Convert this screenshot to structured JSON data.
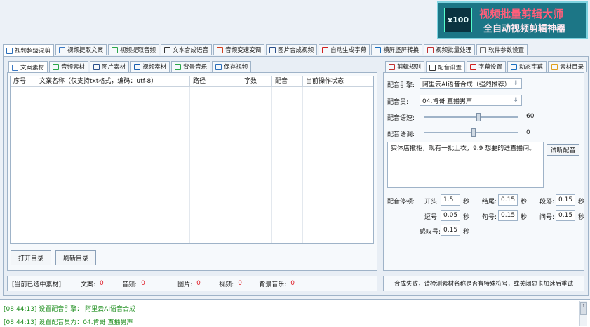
{
  "brand": {
    "badge": "x100",
    "title": "视频批量剪辑大师",
    "subtitle": "全自动视频剪辑神器"
  },
  "main_tabs": [
    {
      "label": "视频超级混剪",
      "icon": "scissors-icon",
      "color": "#2a6db8"
    },
    {
      "label": "视频提取文案",
      "icon": "document-icon",
      "color": "#3a78c2"
    },
    {
      "label": "视频提取音频",
      "icon": "waveform-icon",
      "color": "#2aa64a"
    },
    {
      "label": "文本合成语音",
      "icon": "microphone-icon",
      "color": "#333333"
    },
    {
      "label": "音频变速变调",
      "icon": "gauge-icon",
      "color": "#d04020"
    },
    {
      "label": "图片合成视频",
      "icon": "image-icon",
      "color": "#2a4f8a"
    },
    {
      "label": "自动生成字幕",
      "icon": "font-icon",
      "color": "#d02020"
    },
    {
      "label": "横屏竖屏转换",
      "icon": "rotate-icon",
      "color": "#1a6fbf"
    },
    {
      "label": "视频批量处理",
      "icon": "film-icon",
      "color": "#c03030"
    },
    {
      "label": "软件参数设置",
      "icon": "gear-icon",
      "color": "#666666"
    }
  ],
  "left_tabs": [
    {
      "label": "文案素材",
      "icon": "document-icon",
      "color": "#3a78c2"
    },
    {
      "label": "音频素材",
      "icon": "waveform-icon",
      "color": "#2aa64a"
    },
    {
      "label": "图片素材",
      "icon": "image-icon",
      "color": "#2a4f8a"
    },
    {
      "label": "视频素材",
      "icon": "play-icon",
      "color": "#1a5fb0"
    },
    {
      "label": "背景音乐",
      "icon": "music-icon",
      "color": "#2aa64a"
    },
    {
      "label": "保存视频",
      "icon": "save-icon",
      "color": "#2a6db8"
    }
  ],
  "grid": {
    "columns": [
      "序号",
      "文案名称（仅支持txt格式，编码：utf-8）",
      "路径",
      "字数",
      "配音",
      "当前操作状态"
    ]
  },
  "buttons": {
    "open_dir": "打开目录",
    "refresh_dir": "刷新目录",
    "preview_voice": "试听配音"
  },
  "status": {
    "label": "[当前已选中素材]",
    "items": [
      {
        "label": "文案:",
        "value": "0"
      },
      {
        "label": "音频:",
        "value": "0"
      },
      {
        "label": "图片:",
        "value": "0"
      },
      {
        "label": "视频:",
        "value": "0"
      },
      {
        "label": "背景音乐:",
        "value": "0"
      }
    ]
  },
  "right_tabs": [
    {
      "label": "剪辑规则",
      "icon": "film-icon",
      "color": "#c03030"
    },
    {
      "label": "配音设置",
      "icon": "microphone-icon",
      "color": "#333333"
    },
    {
      "label": "字幕设置",
      "icon": "font-icon",
      "color": "#d02020"
    },
    {
      "label": "动态字幕",
      "icon": "text-box-icon",
      "color": "#1a6fbf"
    },
    {
      "label": "素材目录",
      "icon": "folder-icon",
      "color": "#e0a020"
    }
  ],
  "voice": {
    "engine_label": "配音引擎:",
    "engine_value": "阿里云AI语音合成（强烈推荐）",
    "voice_label": "配音员:",
    "voice_value": "04.肯哥 直播男声",
    "speed_label": "配音语速:",
    "speed_value": "60",
    "speed_fraction": 0.55,
    "pitch_label": "配音语调:",
    "pitch_value": "0",
    "pitch_fraction": 0.5,
    "text": "实体店撤柜，现有一批上衣，9.9 想要的进直播间。"
  },
  "pauses": {
    "title": "配音停顿:",
    "unit": "秒",
    "items": [
      {
        "label": "开头:",
        "value": "1.5"
      },
      {
        "label": "结尾:",
        "value": "0.15"
      },
      {
        "label": "段落:",
        "value": "0.15"
      },
      {
        "label": "逗号:",
        "value": "0.05"
      },
      {
        "label": "句号:",
        "value": "0.15"
      },
      {
        "label": "问号:",
        "value": "0.15"
      },
      {
        "label": "感叹号:",
        "value": "0.15"
      }
    ]
  },
  "error_message": "合成失败，请检测素材名称是否有特殊符号，或关闭显卡加速后重试",
  "logs": [
    "[08:44:13] 设置配音引擎：  阿里云AI语音合成",
    "[08:44:13] 设置配音员为：04.肯哥 直播男声"
  ]
}
